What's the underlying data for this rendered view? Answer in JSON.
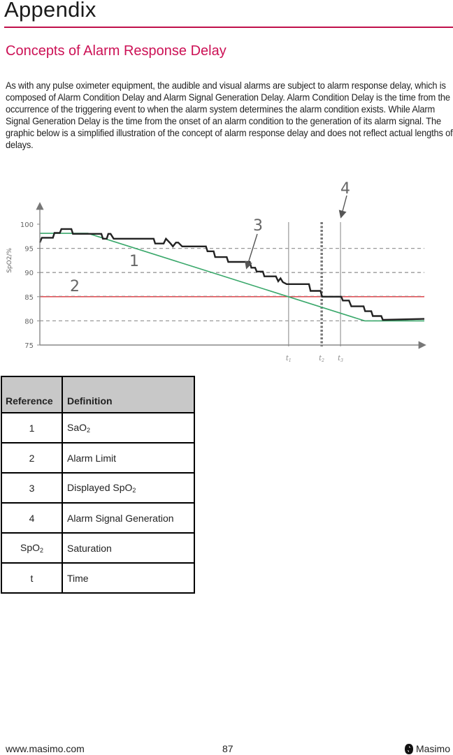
{
  "page": {
    "title": "Appendix",
    "section_title": "Concepts of Alarm Response Delay",
    "intro": "As with any pulse oximeter equipment, the audible and visual alarms are subject to alarm response delay, which is composed of Alarm Condition Delay and Alarm Signal Generation Delay. Alarm Condition Delay is the time from the occurrence of the triggering event to when the alarm system determines the alarm condition exists. While Alarm Signal Generation Delay is the time from the onset of an alarm condition to the generation of its alarm signal. The graphic below is a simplified illustration of the concept of alarm response delay and does not reflect actual lengths of delays."
  },
  "colors": {
    "accent": "#c0104a",
    "sao2_line": "#3aa86b",
    "alarm_limit": "#e0333a",
    "spo2_line": "#222222",
    "grid": "#999999",
    "axis": "#888888",
    "table_header_bg": "#c8c8c8"
  },
  "chart_data": {
    "type": "line",
    "title": "",
    "ylabel": "SpO2/%",
    "xlabel": "",
    "ylim": [
      75,
      100
    ],
    "xlim": [
      0,
      100
    ],
    "y_ticks": [
      75,
      80,
      85,
      90,
      95,
      100
    ],
    "dashed_gridlines": [
      80,
      90,
      95
    ],
    "alarm_limit": 85,
    "time_markers": [
      {
        "label": "t1",
        "x": 64.7,
        "style": "solid"
      },
      {
        "label": "t2",
        "x": 73.3,
        "style": "dotted"
      },
      {
        "label": "t3",
        "x": 78.2,
        "style": "solid"
      }
    ],
    "callouts": [
      {
        "label": "1",
        "target": "SaO2 line"
      },
      {
        "label": "2",
        "target": "Alarm Limit"
      },
      {
        "label": "3",
        "target": "Displayed SpO2"
      },
      {
        "label": "4",
        "target": "Alarm Signal Generation (t3)"
      }
    ],
    "series": [
      {
        "name": "SaO2",
        "ref": "1",
        "x": [
          0,
          12.5,
          84.5,
          100
        ],
        "y": [
          98.1,
          98.1,
          80.0,
          80.0
        ]
      },
      {
        "name": "Displayed SpO2",
        "ref": "3",
        "x": [
          0,
          0.5,
          1.2,
          3.4,
          3.8,
          5.2,
          5.6,
          8.2,
          8.6,
          16.0,
          16.4,
          17.4,
          17.8,
          18.4,
          19.2,
          20.4,
          21.0,
          29.6,
          30.0,
          32.2,
          32.8,
          34.0,
          34.6,
          35.4,
          36.0,
          37.0,
          37.6,
          39.0,
          43.2,
          43.6,
          45.2,
          45.6,
          48.6,
          49.0,
          54.6,
          55.0,
          56.0,
          56.4,
          58.0,
          58.4,
          61.4,
          62.0,
          62.6,
          63.2,
          64.2,
          70.0,
          70.4,
          73.0,
          73.4,
          78.4,
          78.8,
          80.4,
          81.0,
          84.2,
          84.6,
          86.2,
          86.6,
          88.8,
          89.2,
          100
        ],
        "y": [
          96.2,
          97.2,
          97.2,
          97.2,
          98.2,
          98.2,
          99.0,
          99.0,
          98.0,
          98.0,
          97.0,
          97.0,
          98.0,
          98.0,
          97.0,
          97.0,
          97.0,
          97.0,
          96.0,
          96.0,
          97.0,
          96.0,
          95.4,
          96.2,
          96.2,
          95.4,
          95.4,
          95.4,
          95.4,
          94.4,
          94.4,
          93.2,
          93.2,
          92.2,
          92.2,
          91.0,
          91.0,
          90.2,
          90.2,
          89.2,
          89.2,
          88.2,
          88.8,
          88.0,
          87.6,
          87.6,
          86.2,
          86.2,
          85.0,
          85.0,
          84.2,
          84.2,
          83.0,
          83.0,
          82.0,
          82.0,
          81.0,
          81.0,
          80.2,
          80.4
        ]
      }
    ]
  },
  "table": {
    "headers": [
      "Reference",
      "Definition"
    ],
    "rows": [
      {
        "ref": "1",
        "ref_sub": "",
        "def": "SaO",
        "def_sub": "2"
      },
      {
        "ref": "2",
        "ref_sub": "",
        "def": "Alarm Limit",
        "def_sub": ""
      },
      {
        "ref": "3",
        "ref_sub": "",
        "def": "Displayed SpO",
        "def_sub": "2"
      },
      {
        "ref": "4",
        "ref_sub": "",
        "def": "Alarm Signal Generation",
        "def_sub": ""
      },
      {
        "ref": "SpO",
        "ref_sub": "2",
        "def": "Saturation",
        "def_sub": ""
      },
      {
        "ref": "t",
        "ref_sub": "",
        "def": "Time",
        "def_sub": ""
      }
    ]
  },
  "footer": {
    "url": "www.masimo.com",
    "page_number": "87",
    "brand": "Masimo",
    "brand_icon": "masimo-logo-icon"
  }
}
